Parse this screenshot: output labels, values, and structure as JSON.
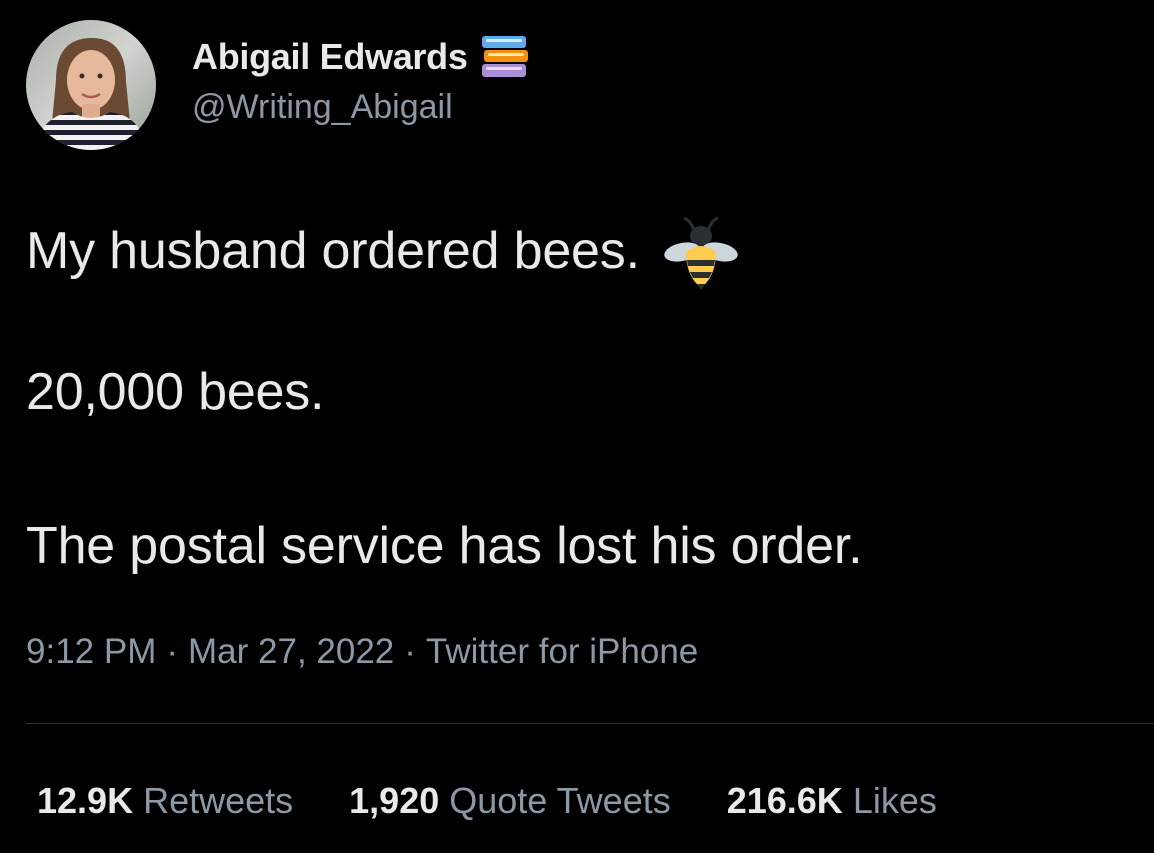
{
  "author": {
    "display_name": "Abigail Edwards",
    "handle": "@Writing_Abigail",
    "name_emoji": "books-icon",
    "avatar": "avatar"
  },
  "tweet": {
    "line1": "My husband ordered bees.",
    "line1_emoji": "bee-icon",
    "line2": "20,000 bees.",
    "line3": "The postal service has lost his order."
  },
  "meta": {
    "time": "9:12 PM",
    "separator": "·",
    "date": "Mar 27, 2022",
    "source": "Twitter for iPhone"
  },
  "stats": {
    "retweets": {
      "count": "12.9K",
      "label": "Retweets"
    },
    "quotes": {
      "count": "1,920",
      "label": "Quote Tweets"
    },
    "likes": {
      "count": "216.6K",
      "label": "Likes"
    }
  },
  "colors": {
    "background": "#000000",
    "text_primary": "#e7e9ea",
    "text_secondary": "#8b98a5",
    "divider": "#2f3336"
  }
}
